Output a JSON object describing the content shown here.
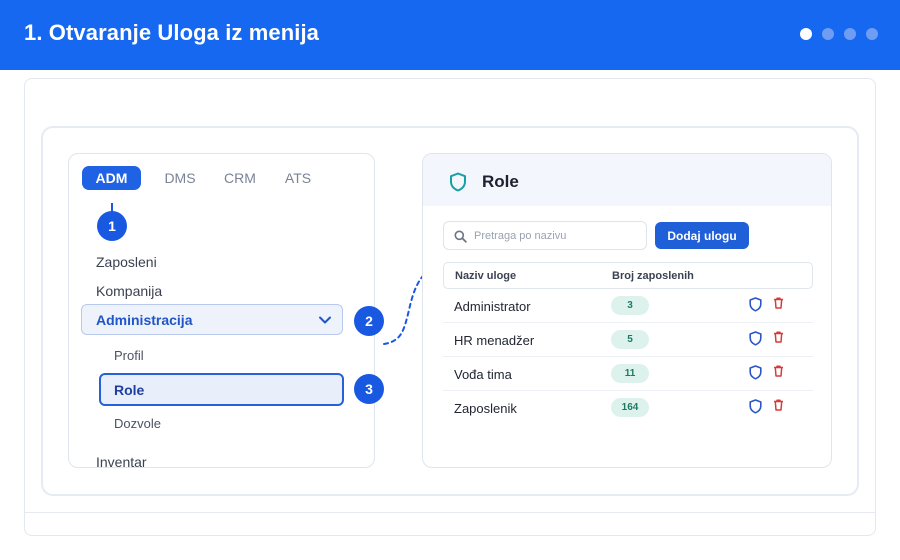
{
  "header": {
    "title": "1. Otvaranje Uloga iz menija",
    "pager": [
      "step-1",
      "step-2",
      "step-3",
      "step-4"
    ],
    "pager_active": 0
  },
  "left": {
    "tabs": [
      "ADM",
      "DMS",
      "CRM",
      "ATS"
    ],
    "active_tab": "ADM",
    "items": [
      "Zaposleni",
      "Kompanija"
    ],
    "group": "Administracija",
    "sub_items": [
      "Profil",
      "Role",
      "Dozvole"
    ],
    "selected": "Role",
    "after": "Inventar"
  },
  "steps": [
    "1",
    "2",
    "3"
  ],
  "right": {
    "title": "Role",
    "search_placeholder": "Pretraga po nazivu",
    "add_button": "Dodaj ulogu",
    "columns": [
      "Naziv uloge",
      "Broj zaposlenih"
    ],
    "rows": [
      {
        "name": "Administrator",
        "count": "3"
      },
      {
        "name": "HR menadžer",
        "count": "5"
      },
      {
        "name": "Vođa tima",
        "count": "11"
      },
      {
        "name": "Zaposlenik",
        "count": "164"
      }
    ],
    "row_actions": [
      "shield-icon",
      "trash-icon"
    ]
  },
  "colors": {
    "header": "#1668f0",
    "accent": "#1f63e4",
    "badge_bg": "#ddf2ec",
    "badge_text": "#1d7a62",
    "trash": "#d63b3b",
    "role_shield": "#159fa6"
  }
}
